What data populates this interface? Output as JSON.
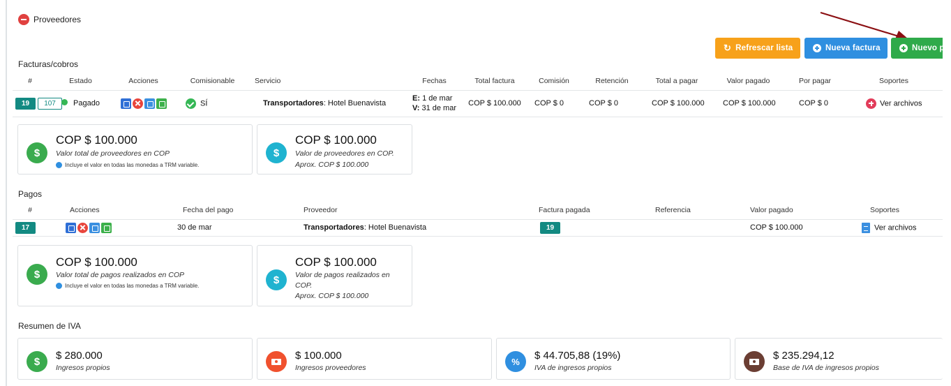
{
  "header": {
    "title": "Proveedores",
    "buttons": {
      "refresh": "Refrescar lista",
      "new_invoice": "Nueva factura",
      "new_other": "Nuevo p"
    }
  },
  "invoices": {
    "title": "Facturas/cobros",
    "columns": [
      "#",
      "Estado",
      "Acciones",
      "Comisionable",
      "Servicio",
      "Fechas",
      "Total factura",
      "Comisión",
      "Retención",
      "Total a pagar",
      "Valor pagado",
      "Por pagar",
      "Soportes"
    ],
    "rows": [
      {
        "id": "19",
        "sub_id": "107",
        "status": "Pagado",
        "commissionable": "SÍ",
        "service_bold": "Transportadores",
        "service_rest": ": Hotel Buenavista",
        "date_e_label": "E:",
        "date_e": "1 de mar",
        "date_v_label": "V:",
        "date_v": "31 de mar",
        "total": "COP $ 100.000",
        "commission": "COP $ 0",
        "retention": "COP $ 0",
        "to_pay": "COP $ 100.000",
        "paid": "COP $ 100.000",
        "pending": "COP $ 0",
        "supports": "Ver archivos"
      }
    ],
    "card1": {
      "amount": "COP $ 100.000",
      "label": "Valor total de proveedores en COP",
      "note": "Incluye el valor en todas las monedas a TRM variable."
    },
    "card2": {
      "amount": "COP $ 100.000",
      "label": "Valor de proveedores en COP.",
      "approx": "Aprox. COP $ 100.000"
    }
  },
  "payments": {
    "title": "Pagos",
    "columns": [
      "#",
      "Acciones",
      "Fecha del pago",
      "Proveedor",
      "Factura pagada",
      "Referencia",
      "Valor pagado",
      "Soportes"
    ],
    "rows": [
      {
        "id": "17",
        "date": "30 de mar",
        "provider_bold": "Transportadores",
        "provider_rest": ": Hotel Buenavista",
        "invoice": "19",
        "reference": "",
        "paid": "COP $ 100.000",
        "supports": "Ver archivos"
      }
    ],
    "card1": {
      "amount": "COP $ 100.000",
      "label": "Valor total de pagos realizados en COP",
      "note": "Incluye el valor en todas las monedas a TRM variable."
    },
    "card2": {
      "amount": "COP $ 100.000",
      "label_line1": "Valor de pagos realizados en",
      "label_line2": "COP.",
      "approx": "Aprox. COP $ 100.000"
    }
  },
  "iva": {
    "title": "Resumen de IVA",
    "cards": [
      {
        "amount": "$ 280.000",
        "label": "Ingresos propios",
        "icon": "dollar-icon",
        "color": "#3aab4e"
      },
      {
        "amount": "$ 100.000",
        "label": "Ingresos proveedores",
        "icon": "money-icon",
        "color": "#f0512e"
      },
      {
        "amount": "$ 44.705,88 (19%)",
        "label": "IVA de ingresos propios",
        "icon": "percent-icon",
        "color": "#2f8fe0"
      },
      {
        "amount": "$ 235.294,12",
        "label": "Base de IVA de ingresos propios",
        "icon": "money-icon",
        "color": "#6b3e33"
      }
    ]
  },
  "colors": {
    "accent_teal": "#138a82",
    "orange": "#f7a11a",
    "blue": "#2f8fe0",
    "green": "#2faa4a",
    "arrow": "#8b0f12"
  }
}
